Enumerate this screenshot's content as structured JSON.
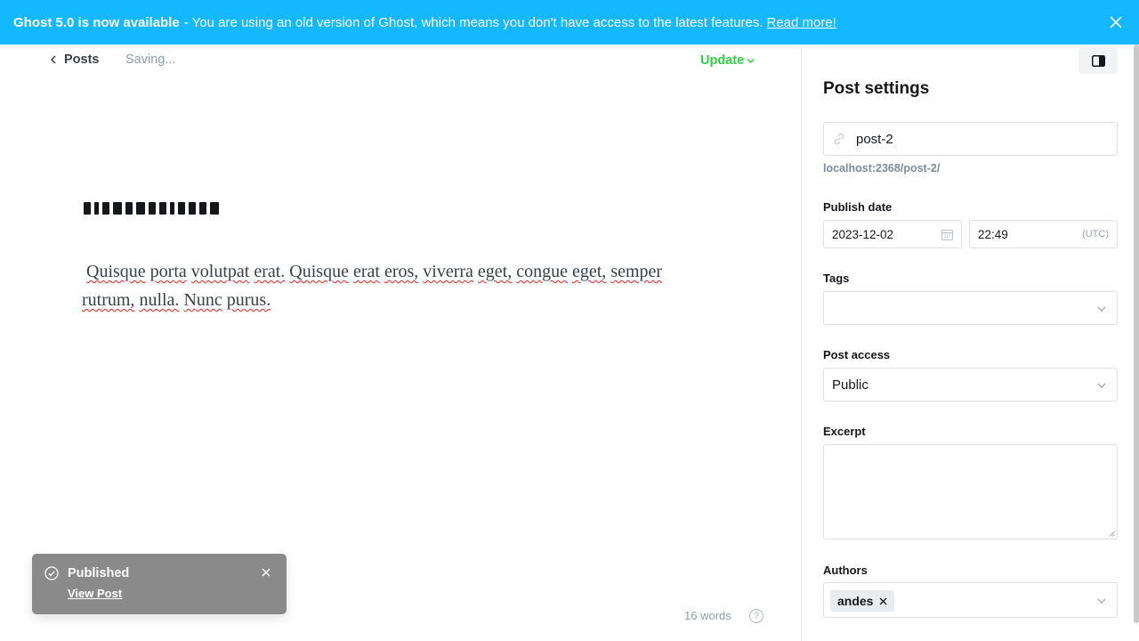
{
  "banner": {
    "headline": "Ghost 5.0 is now available",
    "message": "- You are using an old version of Ghost, which means you don't have access to the latest features.",
    "link": "Read more!"
  },
  "editor": {
    "back_label": "Posts",
    "status": "Saving...",
    "update_label": "Update",
    "body_words": [
      "Quisque",
      "porta",
      "volutpat",
      "erat.",
      "Quisque",
      "erat",
      "eros,",
      "viverra",
      "eget,",
      "congue",
      "eget,",
      "semper",
      "rutrum,",
      "nulla.",
      "Nunc",
      "purus."
    ],
    "word_count": "16 words",
    "help_glyph": "?"
  },
  "toast": {
    "title": "Published",
    "link": "View Post"
  },
  "settings": {
    "title": "Post settings",
    "slug": "post-2",
    "url_hint": "localhost:2368/post-2/",
    "publish_date_label": "Publish date",
    "date": "2023-12-02",
    "time": "22:49",
    "timezone": "(UTC)",
    "tags_label": "Tags",
    "access_label": "Post access",
    "access_value": "Public",
    "excerpt_label": "Excerpt",
    "authors_label": "Authors",
    "author": "andes"
  },
  "colors": {
    "banner_bg": "#14b8ff",
    "update_green": "#30cf43",
    "toast_bg": "#8a8a8a"
  },
  "icons": {
    "banner_close": "close-icon",
    "back": "chevron-left-icon",
    "update_dropdown": "chevron-down-icon",
    "toast_check": "check-circle-icon",
    "toast_close": "close-icon",
    "sidebar_toggle": "sidebar-toggle-icon",
    "slug": "link-icon",
    "date": "calendar-icon"
  }
}
